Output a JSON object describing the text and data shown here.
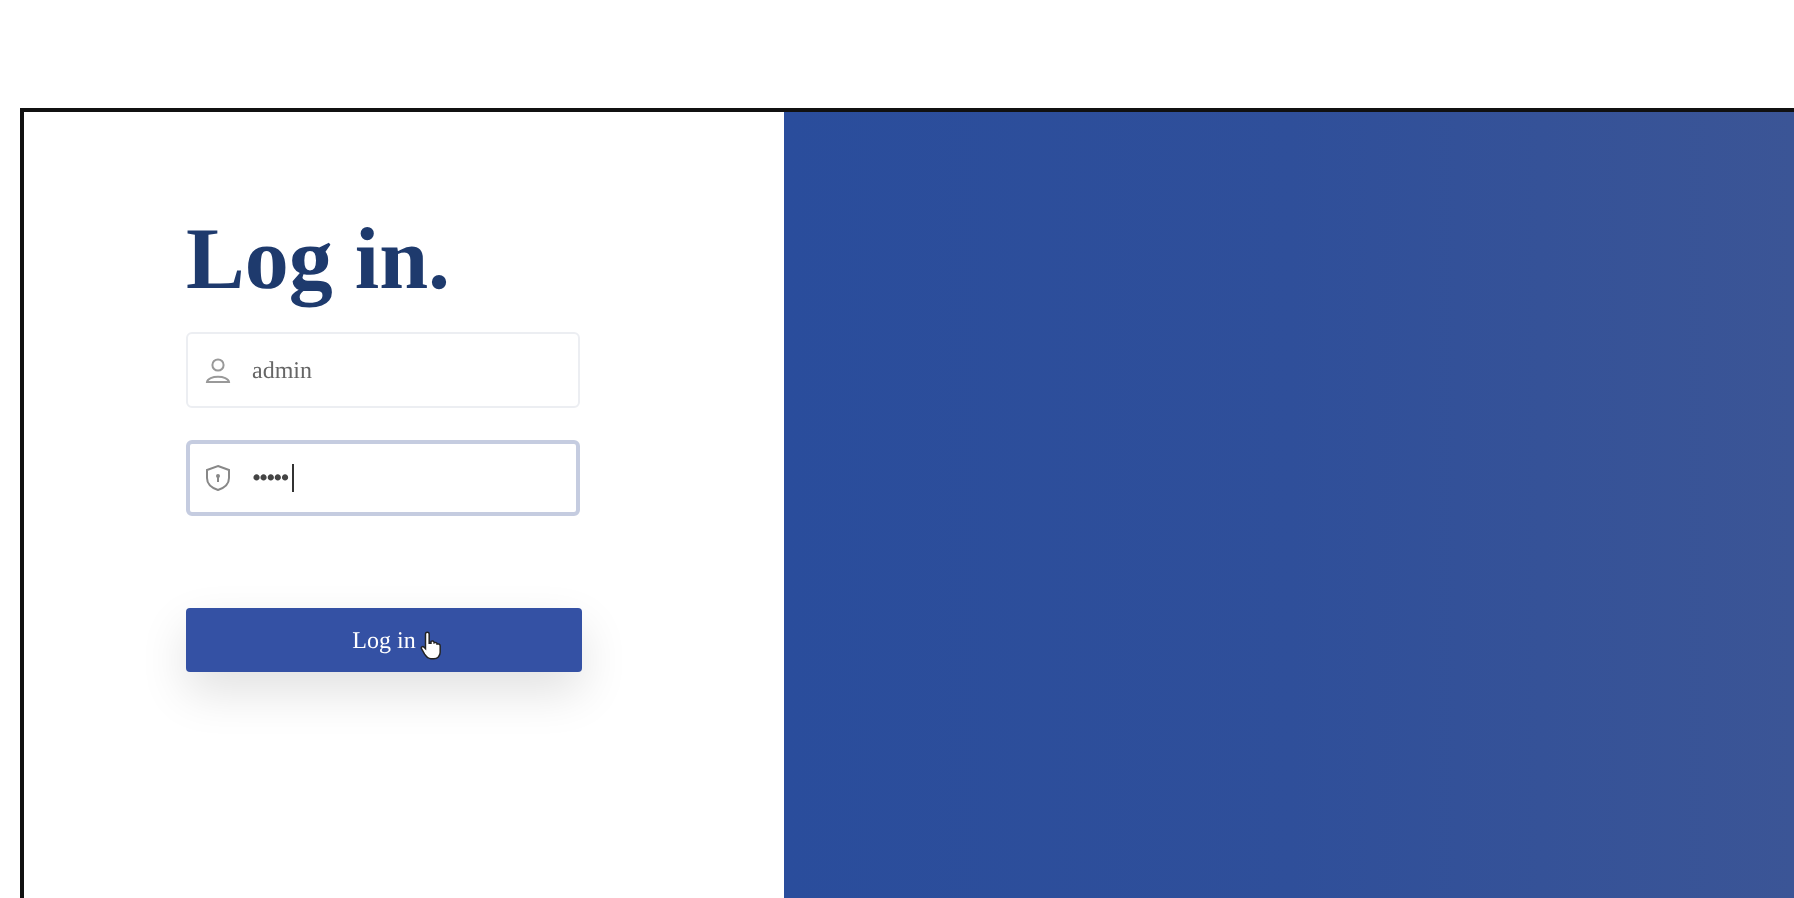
{
  "login": {
    "title": "Log in.",
    "fields": [
      {
        "kind": "username",
        "value": "admin",
        "focused": false
      },
      {
        "kind": "password",
        "value": "•••••",
        "focused": true
      }
    ],
    "button": {
      "label": "Log in"
    }
  }
}
